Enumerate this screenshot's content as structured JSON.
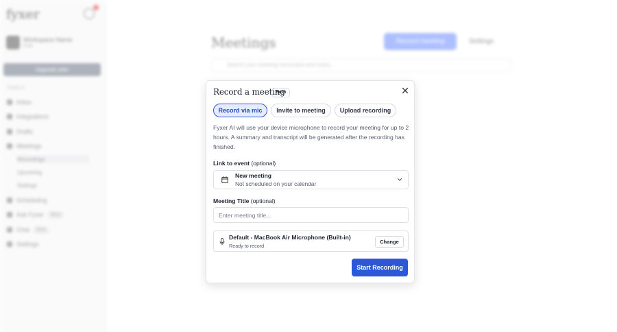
{
  "background": {
    "logo": "fyxer",
    "account": {
      "name": "Workspace Name",
      "plan": "Free"
    },
    "upgrade_label": "Upgrade plan",
    "section_label": "TOOLS",
    "nav": [
      {
        "label": "Inbox"
      },
      {
        "label": "Integrations"
      },
      {
        "label": "Drafts"
      },
      {
        "label": "Meetings"
      }
    ],
    "meetings_sub": [
      "Recordings",
      "Upcoming",
      "Settings"
    ],
    "nav_more": [
      {
        "label": "Scheduling"
      },
      {
        "label": "Ask Fyxer",
        "badge": "Beta"
      },
      {
        "label": "Chat",
        "badge": "Beta"
      },
      {
        "label": "Settings"
      }
    ],
    "page_title": "Meetings",
    "record_button": "Record meeting",
    "settings_button": "Settings",
    "search_placeholder": "Search your meeting transcripts and notes..."
  },
  "modal": {
    "title": "Record a meeting",
    "badge": "Beta",
    "tabs": [
      {
        "label": "Record via mic",
        "active": true
      },
      {
        "label": "Invite to meeting",
        "active": false
      },
      {
        "label": "Upload recording",
        "active": false
      }
    ],
    "description": "Fyxer AI will use your device microphone to record your meeting for up to 2 hours. A summary and transcript will be generated after the recording has finished.",
    "event_label": "Link to event",
    "event_optional": "(optional)",
    "event_title": "New meeting",
    "event_subtitle": "Not scheduled on your calendar",
    "meeting_title_label": "Meeting Title",
    "meeting_title_optional": "(optional)",
    "meeting_title_placeholder": "Enter meeting title...",
    "mic_device": "Default - MacBook Air Microphone (Built-in)",
    "mic_status": "Ready to record",
    "change_label": "Change",
    "start_label": "Start Recording"
  },
  "colors": {
    "accent": "#2d57d9",
    "accent_light": "#e6ecff",
    "notification": "#e63a3a"
  },
  "icons": [
    "close-icon",
    "calendar-icon",
    "chevron-down-icon",
    "microphone-icon",
    "bell-icon"
  ]
}
